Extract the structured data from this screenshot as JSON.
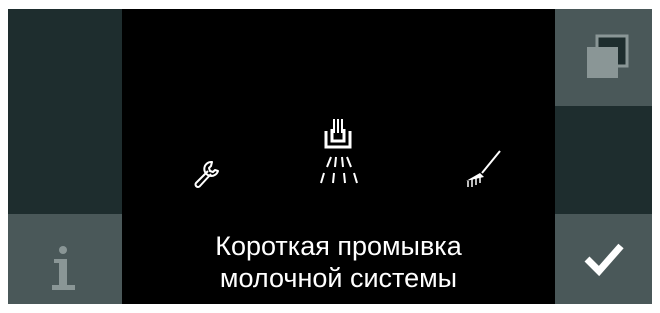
{
  "left_panel": {
    "info_icon": "info-icon"
  },
  "right_panel": {
    "copy_icon": "copy-windows-icon",
    "confirm_icon": "checkmark-icon"
  },
  "center": {
    "icons": [
      "wrench-icon",
      "milk-system-rinse-icon",
      "brush-icon"
    ],
    "caption_line1": "Короткая промывка",
    "caption_line2": "молочной системы"
  },
  "colors": {
    "dark_panel": "#1e2d2e",
    "light_panel": "#4a5859",
    "icon_grey": "#8a9696",
    "background": "#000000",
    "text": "#ffffff"
  }
}
